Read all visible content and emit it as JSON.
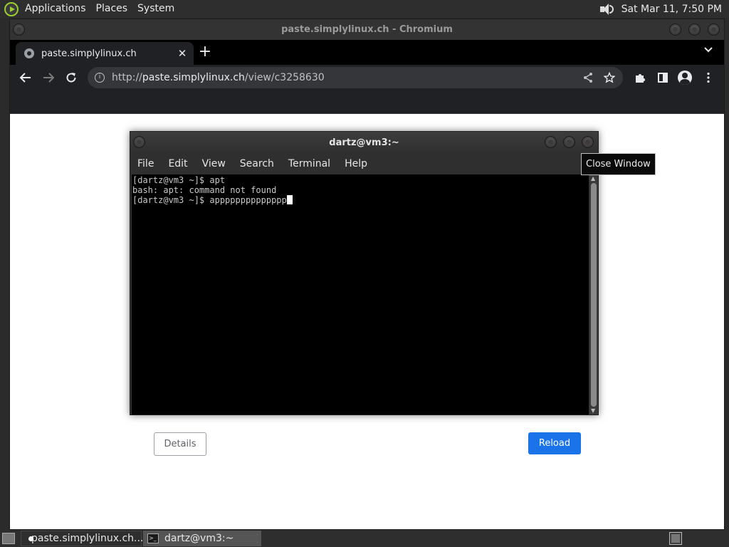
{
  "top_panel": {
    "menus": [
      "Applications",
      "Places",
      "System"
    ],
    "clock": "Sat Mar 11,  7:50 PM",
    "icons": {
      "distro": "distro-logo-icon",
      "volume": "volume-icon"
    }
  },
  "browser": {
    "window_title": "paste.simplylinux.ch - Chromium",
    "tab_title": "paste.simplylinux.ch",
    "url": {
      "scheme": "http://",
      "host": "paste.simplylinux.ch",
      "path": "/view/c3258630"
    }
  },
  "page": {
    "details_label": "Details",
    "reload_label": "Reload"
  },
  "terminal": {
    "title": "dartz@vm3:~",
    "menu": [
      "File",
      "Edit",
      "View",
      "Search",
      "Terminal",
      "Help"
    ],
    "lines": [
      "[dartz@vm3 ~]$ apt",
      "bash: apt: command not found",
      "[dartz@vm3 ~]$ apppppppppppppp"
    ]
  },
  "tooltip": "Close Window",
  "taskbar": {
    "tasks": [
      "paste.simplylinux.ch...",
      "dartz@vm3:~"
    ]
  },
  "colors": {
    "reload_button": "#1a73e8",
    "terminal_bg": "#000000",
    "panel_bg": "#2e2e2e"
  }
}
